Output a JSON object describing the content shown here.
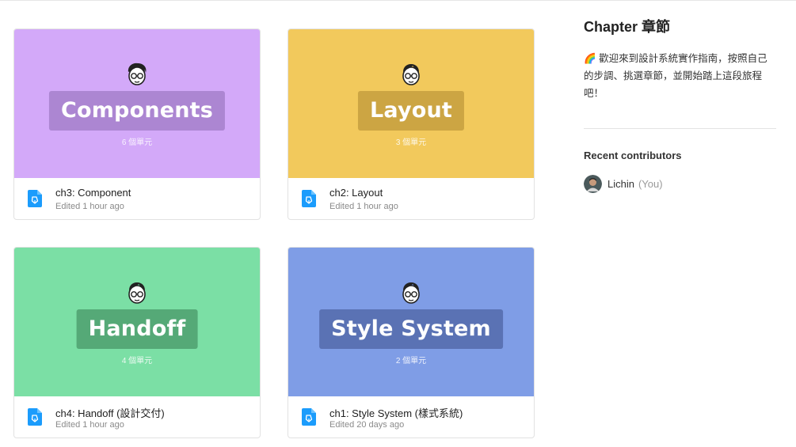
{
  "cards": [
    {
      "title": "Components",
      "units": "6 個單元",
      "file_name": "ch3: Component",
      "edited": "Edited 1 hour ago",
      "bg": "#d3a9f9",
      "box": "#ac86d2"
    },
    {
      "title": "Layout",
      "units": "3 個單元",
      "file_name": "ch2: Layout",
      "edited": "Edited 1 hour ago",
      "bg": "#f2c95c",
      "box": "#cca543"
    },
    {
      "title": "Handoff",
      "units": "4 個單元",
      "file_name": "ch4: Handoff (設計交付)",
      "edited": "Edited 1 hour ago",
      "bg": "#7bdfa5",
      "box": "#55a977"
    },
    {
      "title": "Style System",
      "units": "2 個單元",
      "file_name": "ch1: Style System (樣式系統)",
      "edited": "Edited 20 days ago",
      "bg": "#7f9de6",
      "box": "#5a72b4"
    }
  ],
  "sidebar": {
    "title": "Chapter 章節",
    "emoji": "🌈",
    "description": "歡迎來到設計系統實作指南，按照自己的步調、挑選章節，並開始踏上這段旅程吧！",
    "recent_title": "Recent contributors",
    "contributor": {
      "name": "Lichin",
      "tag": "(You)"
    }
  },
  "icons": {
    "file": "figma-file-icon",
    "avatar": "user-avatar-icon"
  },
  "colors": {
    "file_icon": "#1b9cfc"
  }
}
